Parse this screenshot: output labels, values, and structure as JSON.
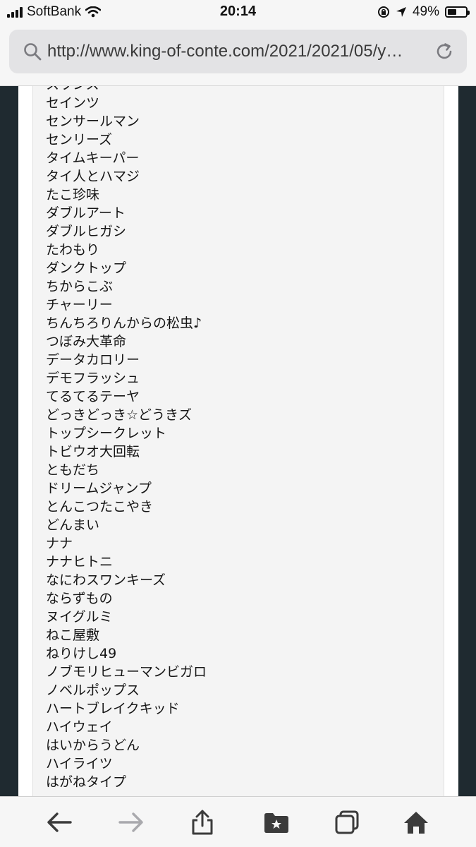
{
  "status_bar": {
    "carrier": "SoftBank",
    "time": "20:14",
    "battery_percent": "49%",
    "battery_level": 0.49
  },
  "url_bar": {
    "url": "http://www.king-of-conte.com/2021/2021/05/y…"
  },
  "names": [
    "スワンス",
    "セインツ",
    "センサールマン",
    "センリーズ",
    "タイムキーパー",
    "タイ人とハマジ",
    "たこ珍味",
    "ダブルアート",
    "ダブルヒガシ",
    "たわもり",
    "ダンクトップ",
    "ちからこぶ",
    "チャーリー",
    "ちんちろりんからの松虫♪",
    "つぼみ大革命",
    "データカロリー",
    "デモフラッシュ",
    "てるてるテーヤ",
    "どっきどっき☆どうきズ",
    "トップシークレット",
    "トビウオ大回転",
    "ともだち",
    "ドリームジャンプ",
    "とんこつたこやき",
    "どんまい",
    "ナナ",
    "ナナヒトニ",
    "なにわスワンキーズ",
    "ならずもの",
    "ヌイグルミ",
    "ねこ屋敷",
    "ねりけし49",
    "ノブモリヒューマンビガロ",
    "ノベルポップス",
    "ハートブレイクキッド",
    "ハイウェイ",
    "はいからうどん",
    "ハイライツ",
    "はがねタイプ"
  ],
  "toolbar": {
    "icons": [
      "back-icon",
      "forward-icon",
      "share-icon",
      "bookmarks-icon",
      "tabs-icon",
      "home-icon"
    ]
  }
}
